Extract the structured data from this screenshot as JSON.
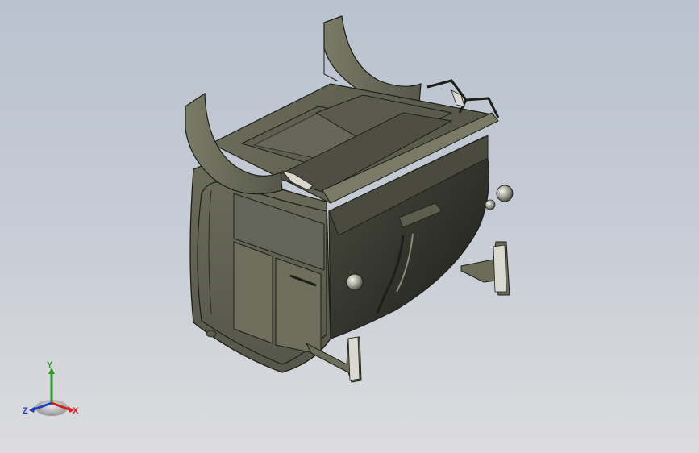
{
  "viewport": {
    "background_top": "#b9c2cf",
    "background_bottom": "#dcdcde",
    "model": {
      "icon": "3d-model-waste-container",
      "body_color": "#5a5b4c",
      "highlight_color": "#8a8a76",
      "outline_color": "#1e1f18"
    }
  },
  "triad": {
    "icon": "coordinate-triad-icon",
    "axes": {
      "y": "Y",
      "x": "X",
      "z": "Z"
    },
    "colors": {
      "y": "#2a9a2a",
      "x": "#d02020",
      "z": "#2040c0"
    }
  }
}
